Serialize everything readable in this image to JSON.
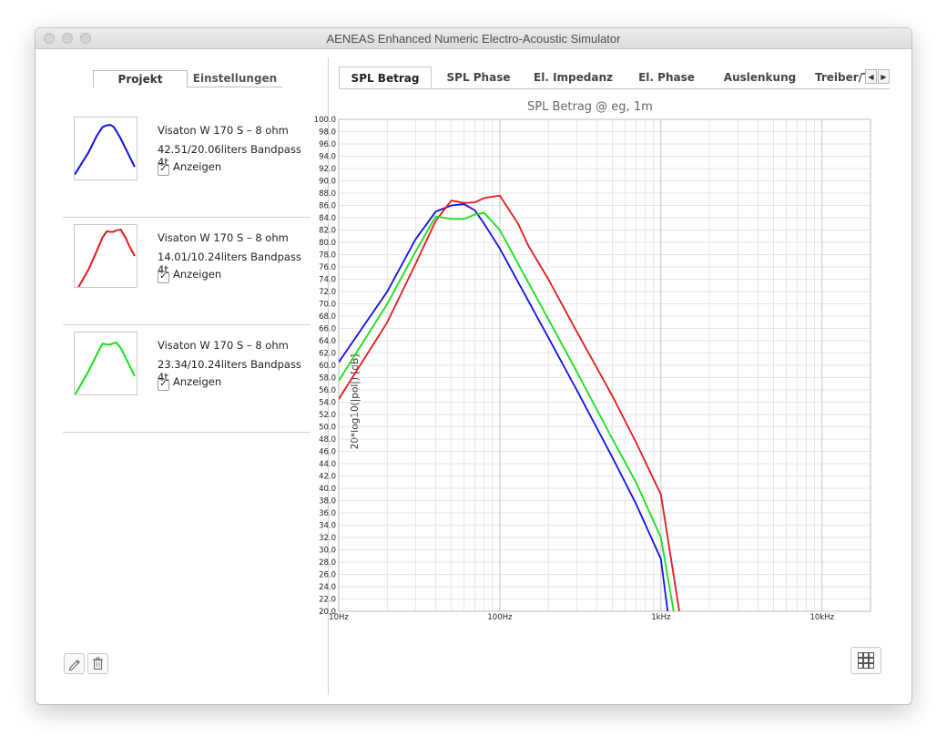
{
  "window": {
    "title": "AENEAS Enhanced Numeric Electro-Acoustic Simulator"
  },
  "left_tabs": {
    "items": [
      {
        "label": "Projekt",
        "active": true
      },
      {
        "label": "Einstellungen",
        "active": false
      }
    ]
  },
  "projects": [
    {
      "name": "Visaton W 170 S – 8 ohm",
      "detail": "42.51/20.06liters Bandpass 4t",
      "show_label": "Anzeigen",
      "checked": true,
      "color": "#1010e6"
    },
    {
      "name": "Visaton W 170 S – 8 ohm",
      "detail": "14.01/10.24liters Bandpass 4t",
      "show_label": "Anzeigen",
      "checked": true,
      "color": "#e21a1a"
    },
    {
      "name": "Visaton W 170 S – 8 ohm",
      "detail": "23.34/10.24liters Bandpass 4t",
      "show_label": "Anzeigen",
      "checked": true,
      "color": "#18e018"
    }
  ],
  "toolbar": {
    "edit_icon": "pencil-icon",
    "delete_icon": "trash-icon",
    "layout_icon": "grid-icon"
  },
  "right_tabs": {
    "items": [
      {
        "label": "SPL Betrag",
        "active": true
      },
      {
        "label": "SPL Phase",
        "active": false
      },
      {
        "label": "El. Impedanz",
        "active": false
      },
      {
        "label": "El. Phase",
        "active": false
      },
      {
        "label": "Auslenkung",
        "active": false
      },
      {
        "label": "Treiber/T",
        "active": false
      }
    ],
    "prev_glyph": "◀",
    "next_glyph": "▶"
  },
  "chart_data": {
    "type": "line",
    "title": "SPL Betrag @ eg, 1m",
    "xlabel": "",
    "ylabel": "20*log10(|pol|) [dB]",
    "xscale": "log",
    "xlim": [
      10,
      20000
    ],
    "ylim": [
      20,
      100
    ],
    "ystep": 2,
    "x_ticks": [
      {
        "value": 10,
        "label": "10Hz"
      },
      {
        "value": 100,
        "label": "100Hz"
      },
      {
        "value": 1000,
        "label": "1kHz"
      },
      {
        "value": 10000,
        "label": "10kHz"
      }
    ],
    "grid": true,
    "series": [
      {
        "color": "#1010e6",
        "x": [
          10,
          20,
          30,
          40,
          50,
          60,
          70,
          80,
          100,
          150,
          200,
          300,
          500,
          700,
          1000,
          1100
        ],
        "y": [
          60.5,
          72,
          80.5,
          85,
          86.0,
          86.2,
          85.2,
          83,
          79,
          70.5,
          64.5,
          56,
          45,
          37.5,
          28.5,
          20
        ]
      },
      {
        "color": "#e21a1a",
        "x": [
          10,
          20,
          30,
          40,
          50,
          60,
          70,
          80,
          100,
          130,
          150,
          200,
          300,
          500,
          700,
          1000,
          1300
        ],
        "y": [
          54.5,
          67,
          76.5,
          83.5,
          86.8,
          86.4,
          86.5,
          87.2,
          87.6,
          83,
          79.5,
          74,
          65.5,
          55,
          47.5,
          39,
          20
        ]
      },
      {
        "color": "#18e018",
        "x": [
          10,
          20,
          30,
          40,
          50,
          60,
          70,
          80,
          100,
          150,
          200,
          300,
          500,
          700,
          1000,
          1200
        ],
        "y": [
          57.5,
          70,
          78.5,
          84.2,
          83.8,
          83.8,
          84.5,
          84.8,
          82,
          73.5,
          67.5,
          59,
          48,
          41,
          32,
          20
        ]
      }
    ]
  }
}
